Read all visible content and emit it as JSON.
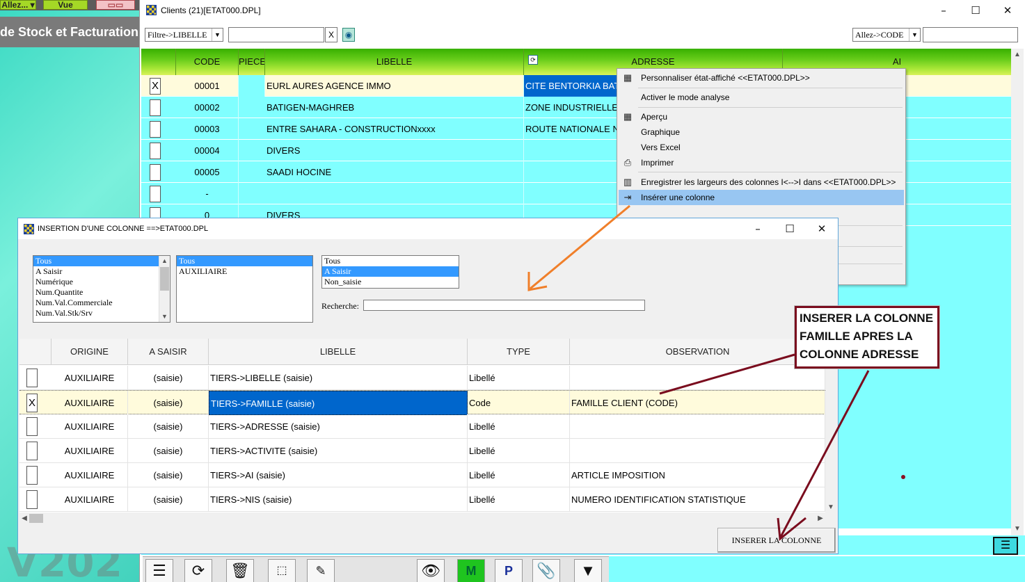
{
  "background_app": {
    "allez_button": "Allez...",
    "vue_button": "Vue",
    "title": "de Stock et Facturation",
    "version_watermark": "V202"
  },
  "clients_window": {
    "title": "Clients (21)[ETAT000.DPL]",
    "filter_select": "Filtre->LIBELLE",
    "clear_button": "X",
    "goto_select": "Allez->CODE",
    "columns": [
      "CODE",
      "PIECE",
      "LIBELLE",
      "ADRESSE",
      "AI"
    ],
    "rows": [
      {
        "check": "X",
        "code": "00001",
        "libelle": "EURL AURES AGENCE IMMO",
        "adresse": "CITE BENTORKIA BATNA"
      },
      {
        "check": "",
        "code": "00002",
        "libelle": "BATIGEN-MAGHREB",
        "adresse": "ZONE INDUSTRIELLE"
      },
      {
        "check": "",
        "code": "00003",
        "libelle": "ENTRE SAHARA - CONSTRUCTIONxxxx",
        "adresse": "ROUTE NATIONALE N"
      },
      {
        "check": "",
        "code": "00004",
        "libelle": "DIVERS",
        "adresse": ""
      },
      {
        "check": "",
        "code": "00005",
        "libelle": "SAADI HOCINE",
        "adresse": ""
      },
      {
        "check": "",
        "code": "-",
        "libelle": "",
        "adresse": ""
      },
      {
        "check": "",
        "code": "0",
        "libelle": "DIVERS",
        "adresse": ""
      }
    ]
  },
  "context_menu": {
    "items": [
      "Personnaliser état-affiché <<ETAT000.DPL>>",
      "Activer le mode analyse",
      "Aperçu",
      "Graphique",
      "Vers Excel",
      "Imprimer",
      "Enregistrer les largeurs des colonnes I<-->I dans <<ETAT000.DPL>>",
      "Insérer une colonne"
    ]
  },
  "dialog": {
    "title": "INSERTION D'UNE COLONNE ==>ETAT000.DPL",
    "list1": [
      "Tous",
      "A Saisir",
      "Numérique",
      "Num.Quantite",
      "Num.Val.Commerciale",
      "Num.Val.Stk/Srv"
    ],
    "list2": [
      "Tous",
      "AUXILIAIRE"
    ],
    "list3": [
      "Tous",
      "A Saisir",
      "Non_saisie"
    ],
    "search_label": "Recherche:",
    "columns": [
      "ORIGINE",
      "A SAISIR",
      "LIBELLE",
      "TYPE",
      "OBSERVATION"
    ],
    "rows": [
      {
        "check": "",
        "origine": "AUXILIAIRE",
        "a_saisir": "(saisie)",
        "libelle": "TIERS->LIBELLE (saisie)",
        "type": "Libellé",
        "observation": ""
      },
      {
        "check": "X",
        "origine": "AUXILIAIRE",
        "a_saisir": "(saisie)",
        "libelle": "TIERS->FAMILLE (saisie)",
        "type": "Code",
        "observation": "FAMILLE CLIENT (CODE)"
      },
      {
        "check": "",
        "origine": "AUXILIAIRE",
        "a_saisir": "(saisie)",
        "libelle": "TIERS->ADRESSE (saisie)",
        "type": "Libellé",
        "observation": ""
      },
      {
        "check": "",
        "origine": "AUXILIAIRE",
        "a_saisir": "(saisie)",
        "libelle": "TIERS->ACTIVITE (saisie)",
        "type": "Libellé",
        "observation": ""
      },
      {
        "check": "",
        "origine": "AUXILIAIRE",
        "a_saisir": "(saisie)",
        "libelle": "TIERS->AI (saisie)",
        "type": "Libellé",
        "observation": "ARTICLE IMPOSITION"
      },
      {
        "check": "",
        "origine": "AUXILIAIRE",
        "a_saisir": "(saisie)",
        "libelle": "TIERS->NIS (saisie)",
        "type": "Libellé",
        "observation": "NUMERO IDENTIFICATION STATISTIQUE"
      }
    ],
    "insert_button": "INSERER LA COLONNE"
  },
  "annotation": {
    "callout_lines": [
      "INSERER LA COLONNE",
      "FAMILLE APRES LA",
      "COLONNE ADRESSE"
    ],
    "arrow_colors": {
      "orange": "#f07f2a",
      "maroon": "#7a0c1e"
    }
  }
}
